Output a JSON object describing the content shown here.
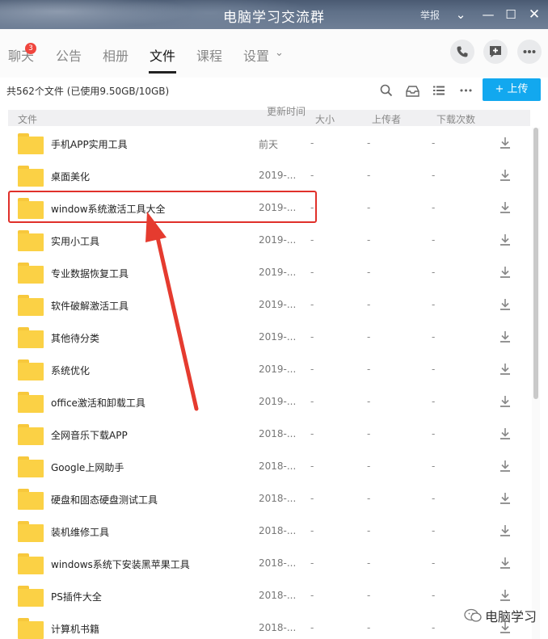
{
  "window": {
    "title": "电脑学习交流群",
    "report_label": "举报",
    "chevron_glyph": "⌄",
    "minimize_glyph": "—",
    "maximize_glyph": "☐",
    "close_glyph": "✕"
  },
  "tabs": [
    {
      "label": "聊天",
      "badge": "3"
    },
    {
      "label": "公告"
    },
    {
      "label": "相册"
    },
    {
      "label": "文件",
      "active": true
    },
    {
      "label": "课程"
    },
    {
      "label": "设置"
    }
  ],
  "tab_chevron": "⌄",
  "infobar": {
    "count_text": "共562个文件 (已使用9.50GB/10GB)",
    "upload_label": "+ 上传",
    "more_glyph": "•••"
  },
  "columns": {
    "file": "文件",
    "updated": "更新时间",
    "size": "大小",
    "uploader": "上传者",
    "downloads": "下载次数"
  },
  "files": [
    {
      "name": "手机APP实用工具",
      "date": "前天",
      "size": "-",
      "uploader": "-",
      "downloads": "-"
    },
    {
      "name": "桌面美化",
      "date": "2019-...",
      "size": "-",
      "uploader": "-",
      "downloads": "-"
    },
    {
      "name": "window系统激活工具大全",
      "date": "2019-...",
      "size": "-",
      "uploader": "-",
      "downloads": "-"
    },
    {
      "name": "实用小工具",
      "date": "2019-...",
      "size": "-",
      "uploader": "-",
      "downloads": "-"
    },
    {
      "name": "专业数据恢复工具",
      "date": "2019-...",
      "size": "-",
      "uploader": "-",
      "downloads": "-"
    },
    {
      "name": "软件破解激活工具",
      "date": "2019-...",
      "size": "-",
      "uploader": "-",
      "downloads": "-"
    },
    {
      "name": "其他待分类",
      "date": "2019-...",
      "size": "-",
      "uploader": "-",
      "downloads": "-"
    },
    {
      "name": "系统优化",
      "date": "2019-...",
      "size": "-",
      "uploader": "-",
      "downloads": "-"
    },
    {
      "name": "office激活和卸载工具",
      "date": "2019-...",
      "size": "-",
      "uploader": "-",
      "downloads": "-"
    },
    {
      "name": "全网音乐下载APP",
      "date": "2018-...",
      "size": "-",
      "uploader": "-",
      "downloads": "-"
    },
    {
      "name": "Google上网助手",
      "date": "2018-...",
      "size": "-",
      "uploader": "-",
      "downloads": "-"
    },
    {
      "name": "硬盘和固态硬盘测试工具",
      "date": "2018-...",
      "size": "-",
      "uploader": "-",
      "downloads": "-"
    },
    {
      "name": "装机维修工具",
      "date": "2018-...",
      "size": "-",
      "uploader": "-",
      "downloads": "-"
    },
    {
      "name": "windows系统下安装黑苹果工具",
      "date": "2018-...",
      "size": "-",
      "uploader": "-",
      "downloads": "-"
    },
    {
      "name": "PS插件大全",
      "date": "2018-...",
      "size": "-",
      "uploader": "-",
      "downloads": "-"
    },
    {
      "name": "计算机书籍",
      "date": "2018-...",
      "size": "-",
      "uploader": "-",
      "downloads": "-"
    }
  ],
  "annotation": {
    "highlight_color": "#e0302a"
  },
  "watermark": {
    "text": "电脑学习"
  },
  "colors": {
    "accent": "#12a8ef",
    "folder": "#fbd145",
    "badge": "#f0463e"
  }
}
